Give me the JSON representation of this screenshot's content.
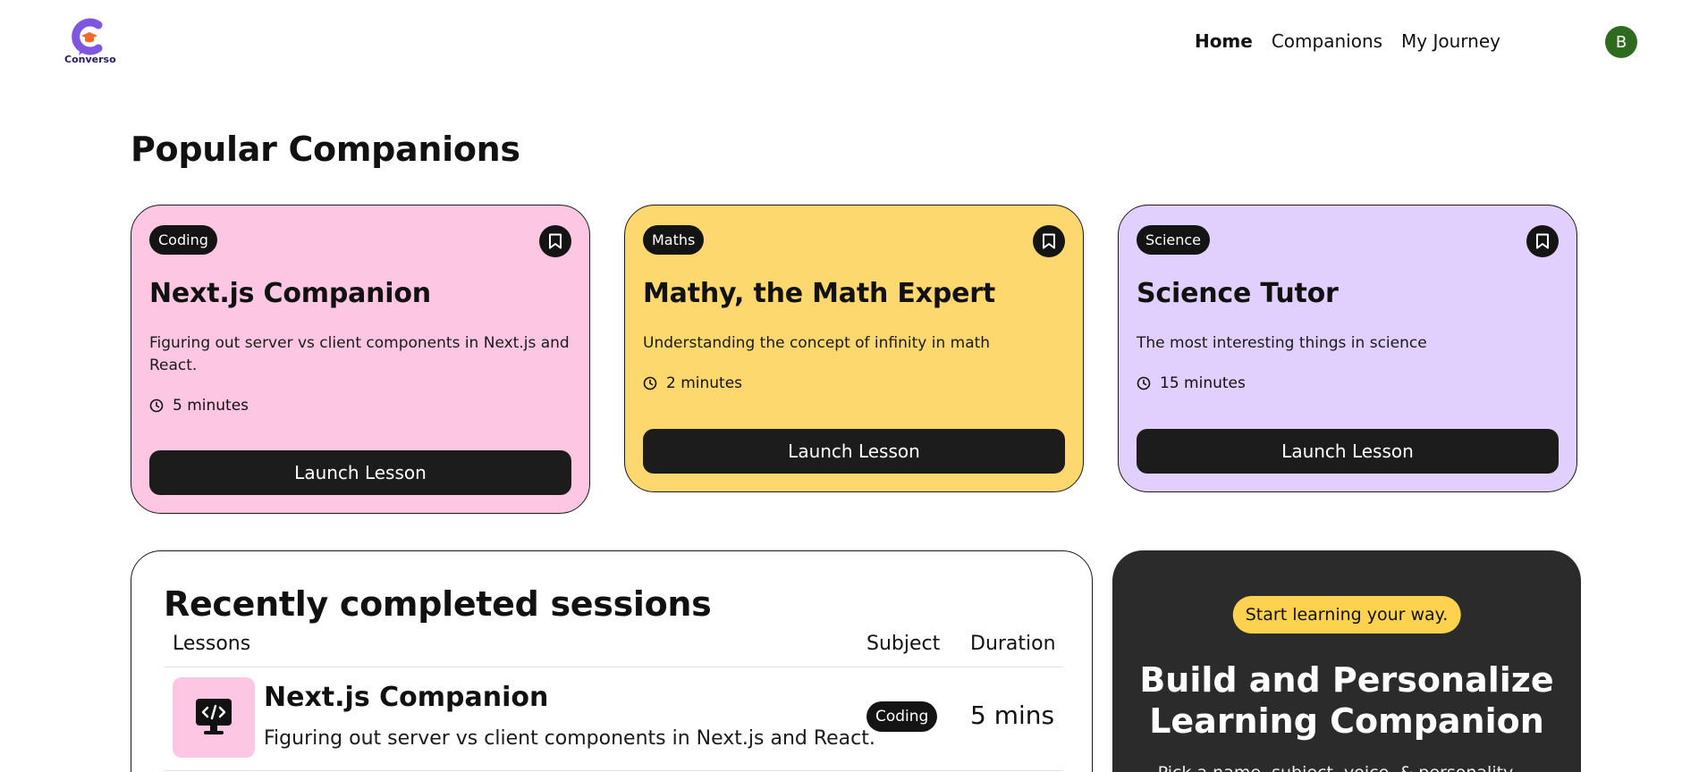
{
  "header": {
    "logo_text": "Converso",
    "nav": [
      {
        "label": "Home",
        "active": true
      },
      {
        "label": "Companions",
        "active": false
      },
      {
        "label": "My Journey",
        "active": false
      }
    ],
    "avatar_initial": "B"
  },
  "popular": {
    "title": "Popular Companions",
    "cards": [
      {
        "subject": "Coding",
        "title": "Next.js Companion",
        "desc": "Figuring out server vs client components in Next.js and React.",
        "duration": "5 minutes",
        "button": "Launch Lesson",
        "color": "#fdc7e3"
      },
      {
        "subject": "Maths",
        "title": "Mathy, the Math Expert",
        "desc": "Understanding the concept of infinity in math",
        "duration": "2 minutes",
        "button": "Launch Lesson",
        "color": "#fdd86f"
      },
      {
        "subject": "Science",
        "title": "Science Tutor",
        "desc": "The most interesting things in science",
        "duration": "15 minutes",
        "button": "Launch Lesson",
        "color": "#e1cffd"
      }
    ]
  },
  "sessions": {
    "title": "Recently completed sessions",
    "columns": [
      "Lessons",
      "Subject",
      "Duration"
    ],
    "rows": [
      {
        "title": "Next.js Companion",
        "desc": "Figuring out server vs client components in Next.js and React.",
        "subject": "Coding",
        "duration": "5 mins"
      }
    ]
  },
  "cta": {
    "pill": "Start learning your way.",
    "title": "Build and Personalize Learning Companion",
    "desc": "Pick a name, subject, voice, & personality — and"
  }
}
